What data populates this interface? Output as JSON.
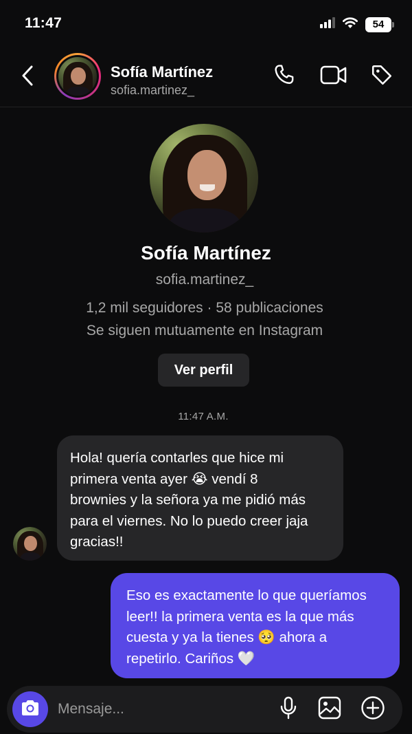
{
  "status_bar": {
    "time": "11:47",
    "battery": "54",
    "icons": [
      "signal-icon",
      "wifi-icon",
      "battery-icon"
    ]
  },
  "header": {
    "name": "Sofía Martínez",
    "handle": "sofia.martinez_",
    "icons": [
      "back-icon",
      "phone-icon",
      "video-icon",
      "tag-icon"
    ]
  },
  "profile": {
    "name": "Sofía Martínez",
    "handle": "sofia.martinez_",
    "stats": "1,2 mil seguidores · 58 publicaciones",
    "mutual": "Se siguen mutuamente en Instagram",
    "view_profile_label": "Ver perfil"
  },
  "conversation": {
    "timestamp": "11:47 A.M.",
    "messages": [
      {
        "direction": "incoming",
        "text": "Hola! quería contarles que hice mi\nprimera venta ayer 😭 vendí 8\nbrownies y la señora ya me pidió más\npara el viernes. No lo puedo creer jaja\ngracias!!"
      },
      {
        "direction": "outgoing",
        "text": "Eso es exactamente lo que queríamos\nleer!! la primera venta es la que más\ncuesta y ya la tienes 🥺 ahora a\nrepetirlo. Cariños 🤍"
      }
    ]
  },
  "composer": {
    "placeholder": "Mensaje...",
    "icons": [
      "camera-icon",
      "microphone-icon",
      "gallery-icon",
      "add-icon"
    ]
  },
  "colors": {
    "background": "#0c0c0d",
    "incoming_bubble": "#262628",
    "outgoing_bubble": "#5848e6",
    "secondary_text": "#a8a8a8"
  }
}
